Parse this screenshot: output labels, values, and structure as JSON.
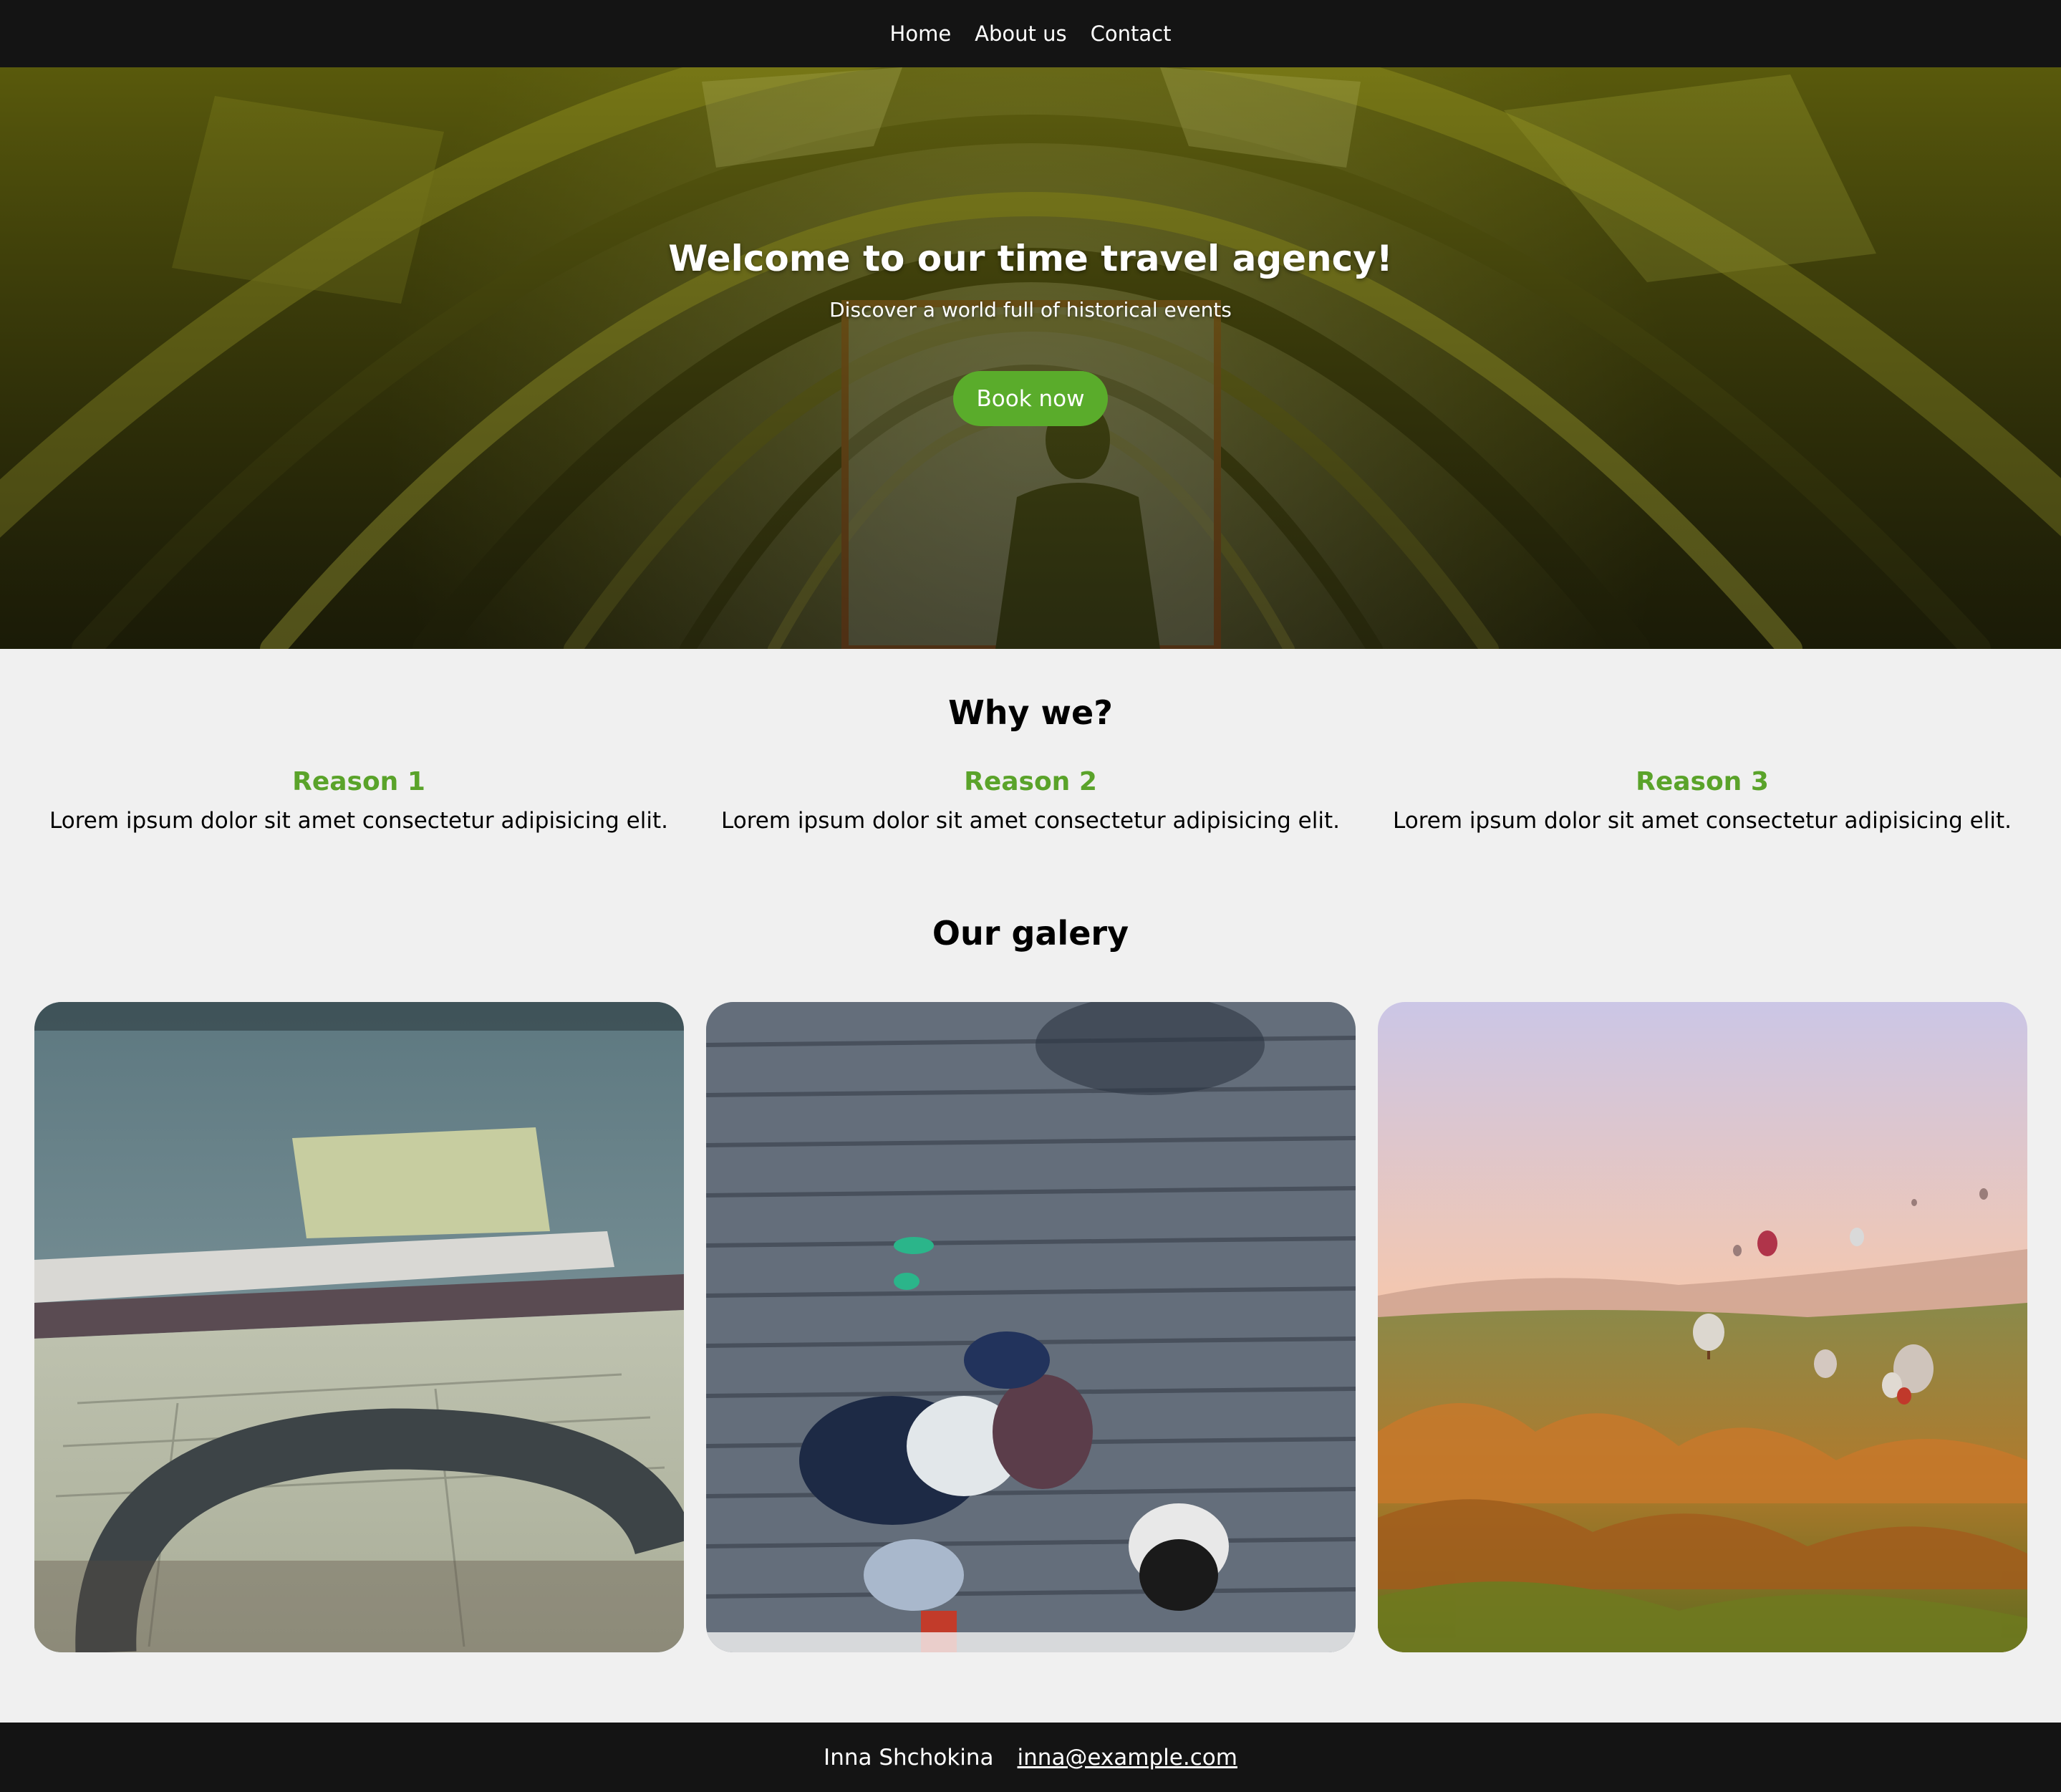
{
  "nav": {
    "items": [
      {
        "label": "Home"
      },
      {
        "label": "About us"
      },
      {
        "label": "Contact"
      }
    ]
  },
  "hero": {
    "title": "Welcome to our time travel agency!",
    "subtitle": "Discover a world full of historical events",
    "button_label": "Book now",
    "image_icon": "time-tunnel-photo"
  },
  "why": {
    "title": "Why we?",
    "reasons": [
      {
        "title": "Reason 1",
        "text": "Lorem ipsum dolor sit amet consectetur adipisicing elit."
      },
      {
        "title": "Reason 2",
        "text": "Lorem ipsum dolor sit amet consectetur adipisicing elit."
      },
      {
        "title": "Reason 3",
        "text": "Lorem ipsum dolor sit amet consectetur adipisicing elit."
      }
    ]
  },
  "gallery": {
    "title": "Our galery",
    "images": [
      {
        "icon": "map-compass-photo"
      },
      {
        "icon": "friends-on-boardwalk-photo"
      },
      {
        "icon": "hot-air-balloons-photo"
      }
    ]
  },
  "footer": {
    "name": "Inna Shchokina",
    "email": "inna@example.com"
  },
  "colors": {
    "nav_bg": "#141414",
    "accent_green": "#5aac2b",
    "reason_green": "#5aa32a",
    "page_bg": "#f0f0f0"
  }
}
